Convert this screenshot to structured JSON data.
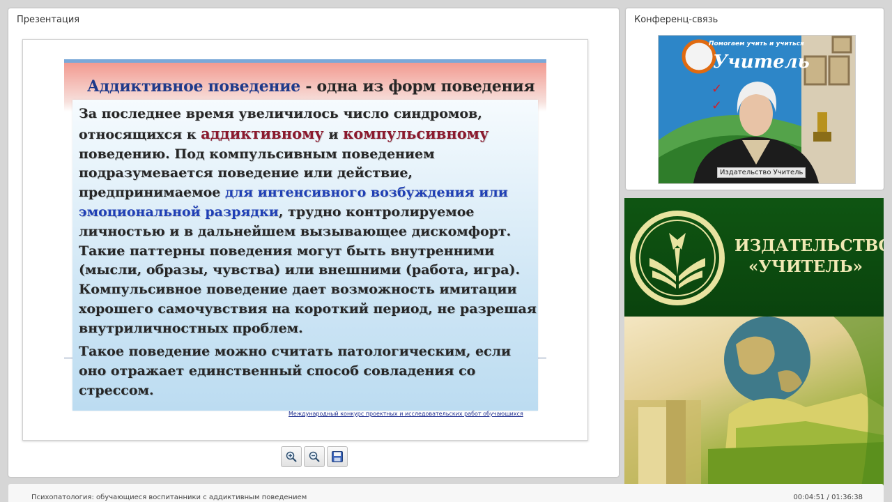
{
  "presentation_panel": {
    "title": "Презентация"
  },
  "slide": {
    "title_highlight": "Аддиктивное поведение",
    "title_rest": " - одна из форм поведения",
    "para1": {
      "t1": "За последнее время увеличилось число синдромов, относящихся к ",
      "red1": "аддиктивному",
      "t2": " и ",
      "red2": "компульсивному",
      "t3": " поведению. Под компульсивным поведением подразумевается поведение или действие, предпринимаемое ",
      "blue1": "для интенсивного возбуждения или эмоциональной разрядки",
      "t4": ", трудно контролируемое личностью и в дальнейшем вызывающее дискомфорт. Такие паттерны поведения могут быть внутренними (мысли, образы, чувства) или внешними (работа, игра). Компульсивное поведение дает возможность имитации хорошего самочувствия на короткий период, не разрешая внутриличностных проблем."
    },
    "para2": "Такое поведение можно считать патологическим, если оно отражает единственный способ совладения со стрессом.",
    "footer_link": "Международный конкурс проектных и исследовательских работ обучающихся"
  },
  "toolbar": {
    "zoom_in_icon": "zoom-in-icon",
    "zoom_out_icon": "zoom-out-icon",
    "save_icon": "floppy-disk-icon"
  },
  "conference_panel": {
    "title": "Конференц-связь",
    "video_label": "Издательство Учитель",
    "banner_logo_text": "Учитель",
    "banner_slogan": "Помогаем учить и учиться"
  },
  "brand": {
    "line1": "ИЗДАТЕЛЬСТВО",
    "line2": "«УЧИТЕЛЬ»",
    "colors": {
      "green": "#0f5512",
      "gold": "#f0e8b4"
    }
  },
  "status_bar": {
    "lecture_title": "Психопатология: обучающиеся воспитанники с аддиктивным поведением",
    "time": "00:04:51 / 01:36:38"
  }
}
